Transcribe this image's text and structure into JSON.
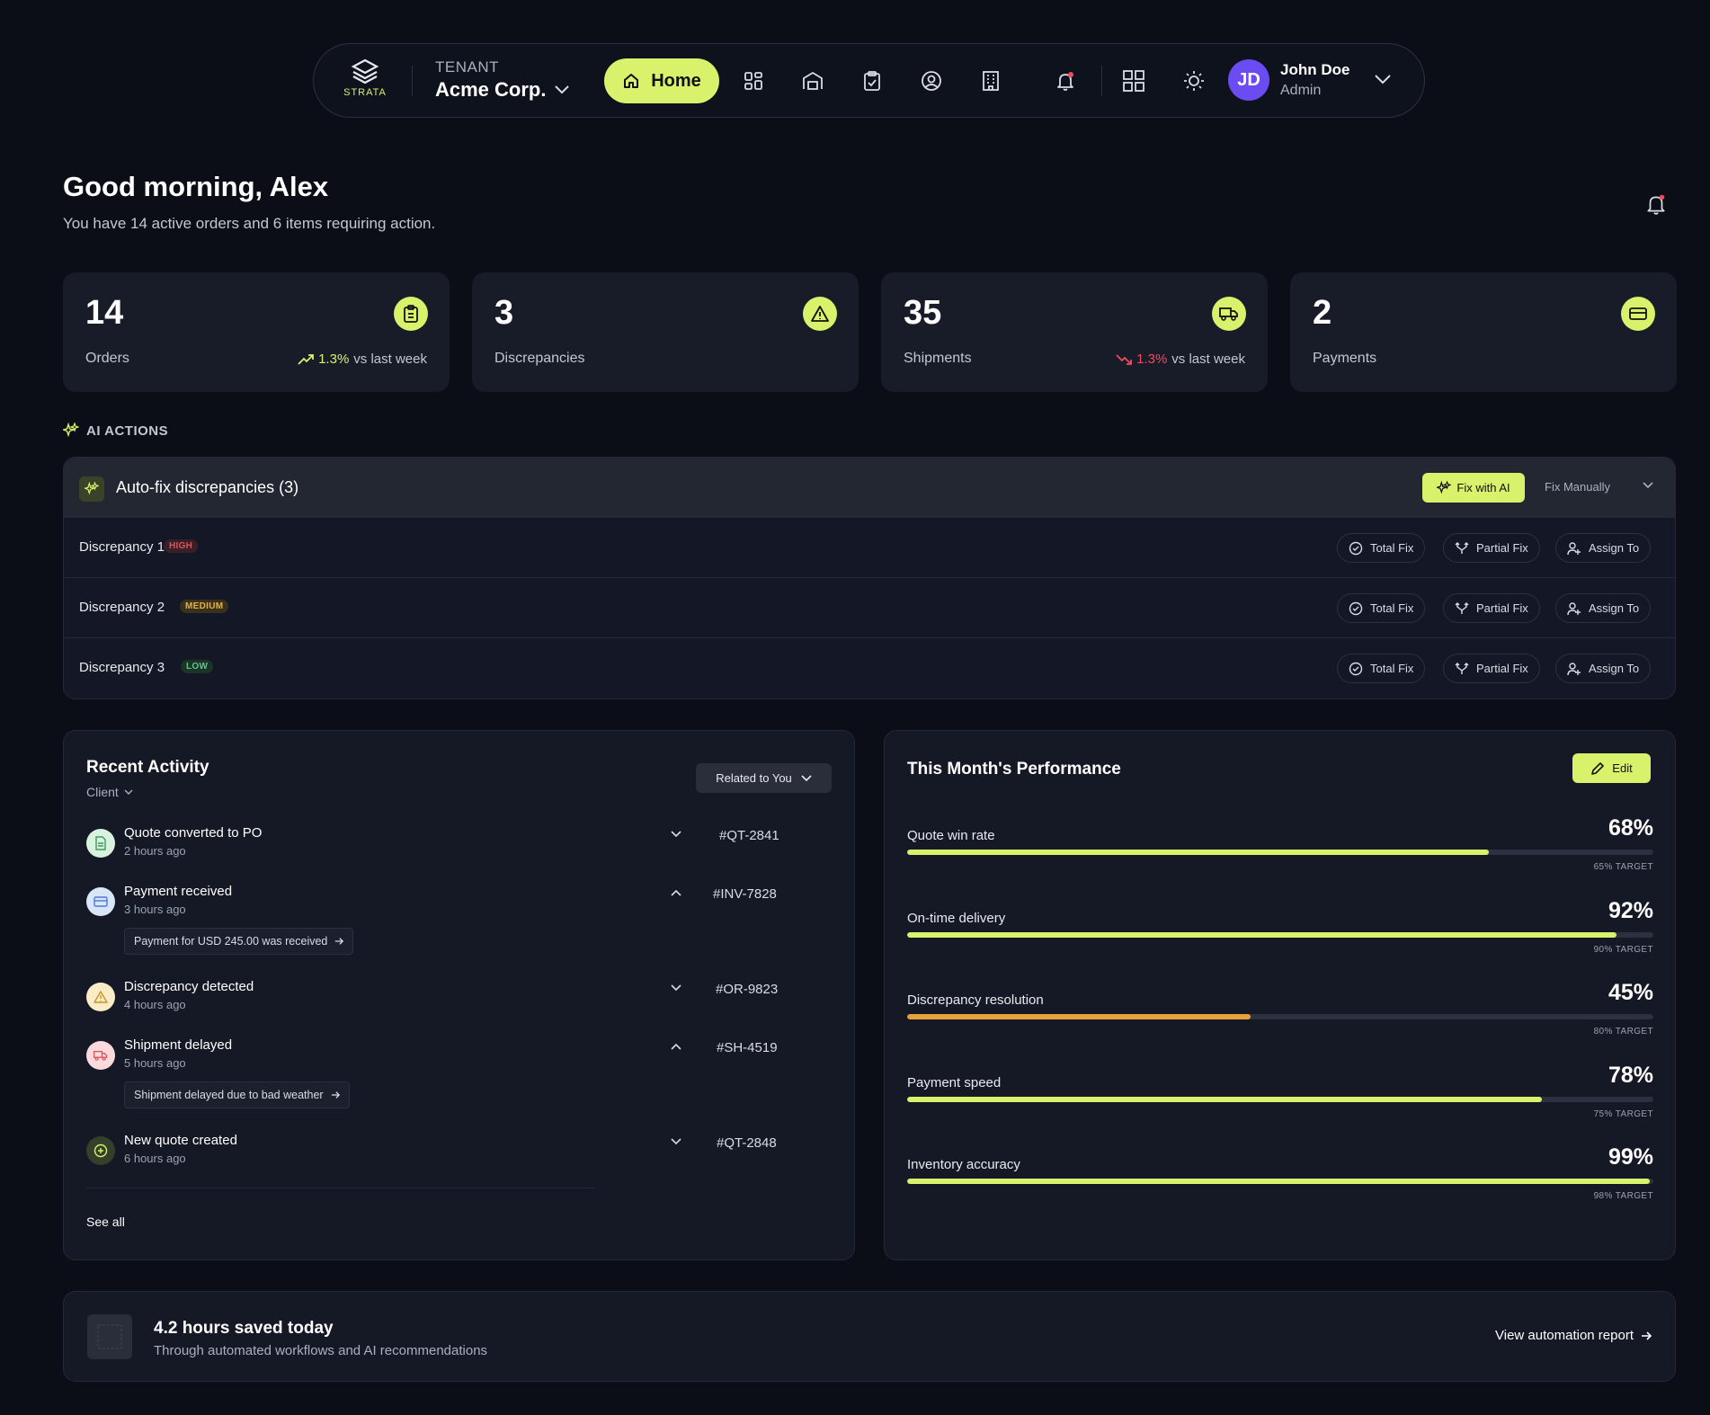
{
  "nav": {
    "logo_text": "STRATA",
    "tenant_label": "TENANT",
    "tenant_name": "Acme Corp.",
    "home_label": "Home",
    "user_initials": "JD",
    "user_name": "John Doe",
    "user_role": "Admin",
    "icons": [
      "grid-layout-icon",
      "warehouse-icon",
      "clipboard-check-icon",
      "user-circle-icon",
      "building-icon",
      "bell-icon",
      "apps-grid-icon",
      "sun-icon"
    ]
  },
  "greeting": {
    "title": "Good morning, Alex",
    "subtitle": "You have 14 active orders and 6 items requiring action."
  },
  "stats": [
    {
      "value": "14",
      "label": "Orders",
      "icon": "clipboard-icon",
      "trend": "1.3%",
      "trend_dir": "up",
      "trend_suffix": "vs last week"
    },
    {
      "value": "3",
      "label": "Discrepancies",
      "icon": "warning-icon"
    },
    {
      "value": "35",
      "label": "Shipments",
      "icon": "truck-icon",
      "trend": "1.3%",
      "trend_dir": "down",
      "trend_suffix": "vs last week"
    },
    {
      "value": "2",
      "label": "Payments",
      "icon": "card-icon"
    }
  ],
  "ai": {
    "section_label": "AI ACTIONS",
    "title": "Auto-fix discrepancies (3)",
    "fix_ai_label": "Fix with AI",
    "fix_manual_label": "Fix Manually",
    "total_fix_label": "Total Fix",
    "partial_fix_label": "Partial Fix",
    "assign_label": "Assign To",
    "discrepancies": [
      {
        "name": "Discrepancy 1",
        "severity": "HIGH"
      },
      {
        "name": "Discrepancy 2",
        "severity": "MEDIUM"
      },
      {
        "name": "Discrepancy 3",
        "severity": "LOW"
      }
    ]
  },
  "activity": {
    "title": "Recent Activity",
    "filter": "Client",
    "related_label": "Related to You",
    "items": [
      {
        "title": "Quote converted to PO",
        "time": "2 hours ago",
        "id": "#QT-2841",
        "expanded": false
      },
      {
        "title": "Payment received",
        "time": "3 hours ago",
        "id": "#INV-7828",
        "expanded": true,
        "note": "Payment for USD 245.00 was received"
      },
      {
        "title": "Discrepancy detected",
        "time": "4 hours ago",
        "id": "#OR-9823",
        "expanded": false
      },
      {
        "title": "Shipment delayed",
        "time": "5 hours ago",
        "id": "#SH-4519",
        "expanded": true,
        "note": "Shipment delayed due to bad weather"
      },
      {
        "title": "New quote created",
        "time": "6 hours ago",
        "id": "#QT-2848",
        "expanded": false
      }
    ],
    "see_all": "See all"
  },
  "performance": {
    "title": "This Month's Performance",
    "edit_label": "Edit",
    "metrics": [
      {
        "label": "Quote win rate",
        "value": "68%",
        "target": "65% TARGET",
        "pct": 78,
        "color": "#d9f26b"
      },
      {
        "label": "On-time delivery",
        "value": "92%",
        "target": "90% TARGET",
        "pct": 95,
        "color": "#d9f26b"
      },
      {
        "label": "Discrepancy resolution",
        "value": "45%",
        "target": "80% TARGET",
        "pct": 46,
        "color": "#e6a239"
      },
      {
        "label": "Payment speed",
        "value": "78%",
        "target": "75% TARGET",
        "pct": 85,
        "color": "#d9f26b"
      },
      {
        "label": "Inventory accuracy",
        "value": "99%",
        "target": "98% TARGET",
        "pct": 99.5,
        "color": "#d9f26b"
      }
    ]
  },
  "footer": {
    "title": "4.2 hours saved today",
    "subtitle": "Through automated workflows and AI recommendations",
    "link": "View automation report"
  }
}
